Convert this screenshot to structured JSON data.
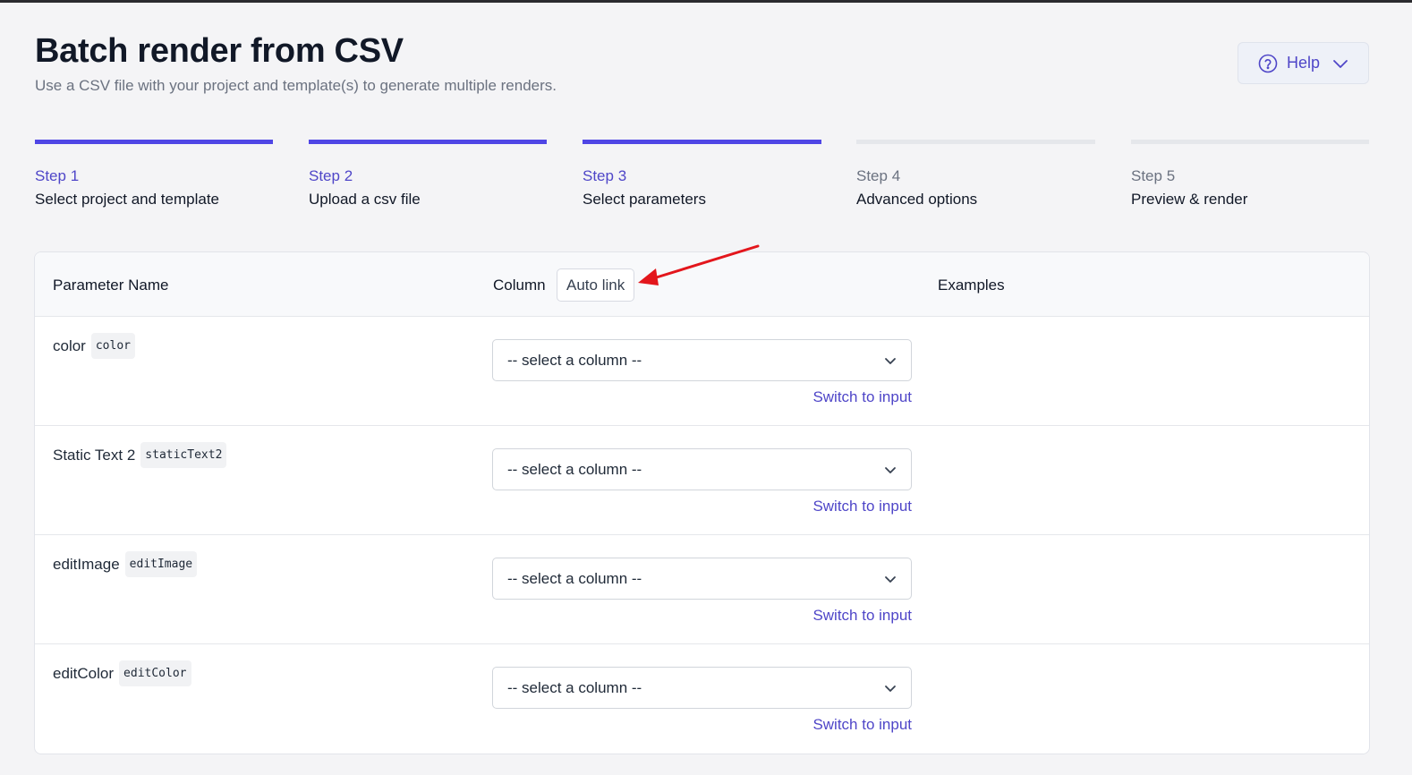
{
  "header": {
    "title": "Batch render from CSV",
    "subtitle": "Use a CSV file with your project and template(s) to generate multiple renders.",
    "help_label": "Help"
  },
  "steps": [
    {
      "number": "Step 1",
      "label": "Select project and template",
      "status": "complete"
    },
    {
      "number": "Step 2",
      "label": "Upload a csv file",
      "status": "complete"
    },
    {
      "number": "Step 3",
      "label": "Select parameters",
      "status": "current"
    },
    {
      "number": "Step 4",
      "label": "Advanced options",
      "status": "upcoming"
    },
    {
      "number": "Step 5",
      "label": "Preview & render",
      "status": "upcoming"
    }
  ],
  "table": {
    "headers": {
      "parameter_name": "Parameter Name",
      "column": "Column",
      "auto_link": "Auto link",
      "examples": "Examples"
    },
    "rows": [
      {
        "name": "color",
        "code": "color",
        "select_value": "-- select a column --",
        "switch_label": "Switch to input"
      },
      {
        "name": "Static Text 2",
        "code": "staticText2",
        "select_value": "-- select a column --",
        "switch_label": "Switch to input"
      },
      {
        "name": "editImage",
        "code": "editImage",
        "select_value": "-- select a column --",
        "switch_label": "Switch to input"
      },
      {
        "name": "editColor",
        "code": "editColor",
        "select_value": "-- select a column --",
        "switch_label": "Switch to input"
      }
    ]
  },
  "colors": {
    "accent": "#4f46e5",
    "annotation_arrow": "#e3161c"
  },
  "icons": {
    "help": "question-circle-icon",
    "help_chevron": "chevron-down-icon",
    "select_chevron": "chevron-down-icon"
  }
}
